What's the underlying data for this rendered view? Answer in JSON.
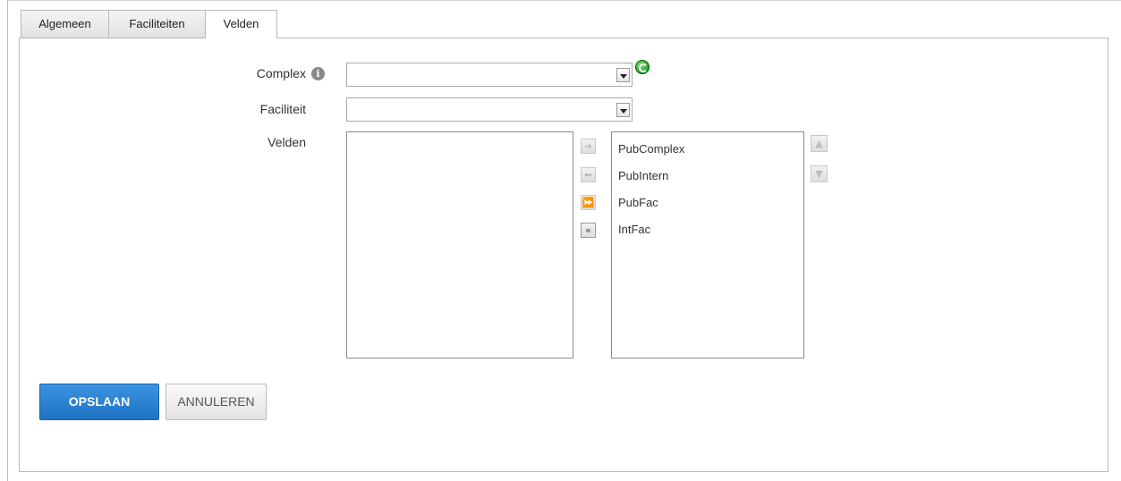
{
  "tabs": [
    {
      "label": "Algemeen",
      "active": false
    },
    {
      "label": "Faciliteiten",
      "active": false
    },
    {
      "label": "Velden",
      "active": true
    }
  ],
  "form": {
    "complex": {
      "label": "Complex",
      "value": "",
      "info_icon": "info-icon",
      "action_icon": "refresh-icon"
    },
    "faciliteit": {
      "label": "Faciliteit",
      "value": ""
    },
    "velden": {
      "label": "Velden",
      "available": [],
      "selected": [
        "PubComplex",
        "PubIntern",
        "PubFac",
        "IntFac"
      ]
    }
  },
  "transfer_buttons": [
    {
      "icon": "arrow-right-icon",
      "glyph": "➜",
      "enabled": false
    },
    {
      "icon": "arrow-left-icon",
      "glyph": "⬅",
      "enabled": false
    },
    {
      "icon": "double-arrow-right-icon",
      "glyph": "⏩",
      "enabled": false
    },
    {
      "icon": "double-arrow-left-icon",
      "glyph": "«",
      "enabled": true
    }
  ],
  "order_buttons": [
    {
      "icon": "move-up-icon",
      "glyph": "▲",
      "enabled": false
    },
    {
      "icon": "move-down-icon",
      "glyph": "▼",
      "enabled": false
    }
  ],
  "actions": {
    "save_label": "OPSLAAN",
    "cancel_label": "ANNULEREN"
  },
  "colors": {
    "primary": "#1f72c4",
    "refresh": "#1f9a1f"
  }
}
